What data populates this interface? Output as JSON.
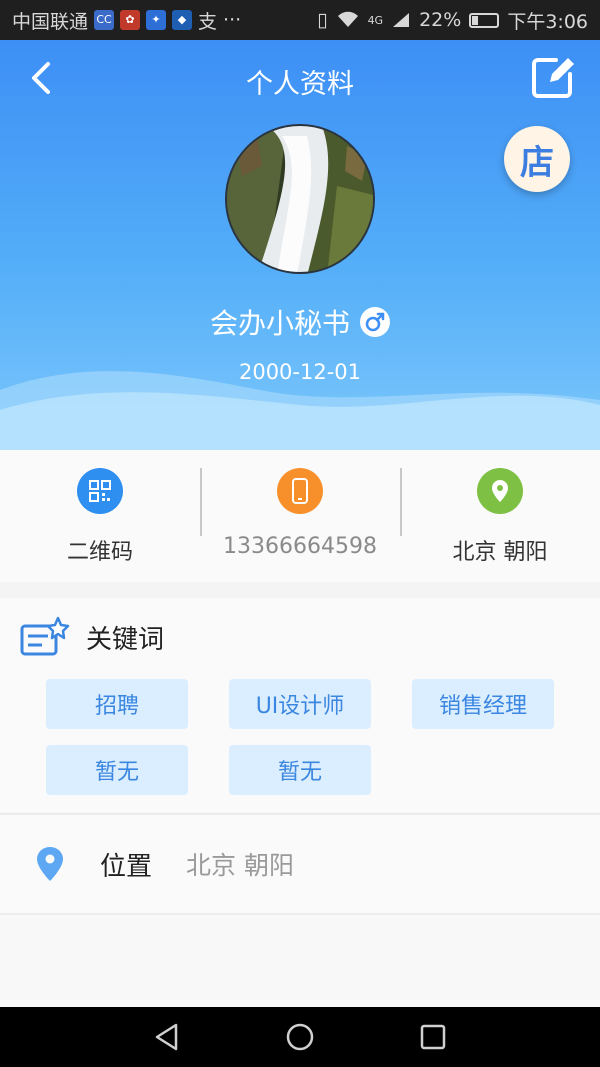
{
  "status_bar": {
    "carrier": "中国联通",
    "signal": "4G",
    "battery": "22%",
    "time": "下午3:06",
    "dots": "···",
    "badge_letter": "支"
  },
  "header": {
    "title": "个人资料",
    "store_label": "店",
    "nickname": "会办小秘书",
    "birthday": "2000-12-01"
  },
  "info": {
    "qrcode_label": "二维码",
    "phone": "13366664598",
    "location": "北京 朝阳"
  },
  "keywords": {
    "title": "关键词",
    "tags": [
      "招聘",
      "UI设计师",
      "销售经理",
      "暂无",
      "暂无"
    ]
  },
  "location_row": {
    "label": "位置",
    "value": "北京 朝阳"
  },
  "colors": {
    "primary": "#3a86e0",
    "header_top": "#3d8ff5",
    "qr_icon": "#2f8ff0",
    "phone_icon": "#f7902a",
    "location_icon": "#7dc043"
  }
}
